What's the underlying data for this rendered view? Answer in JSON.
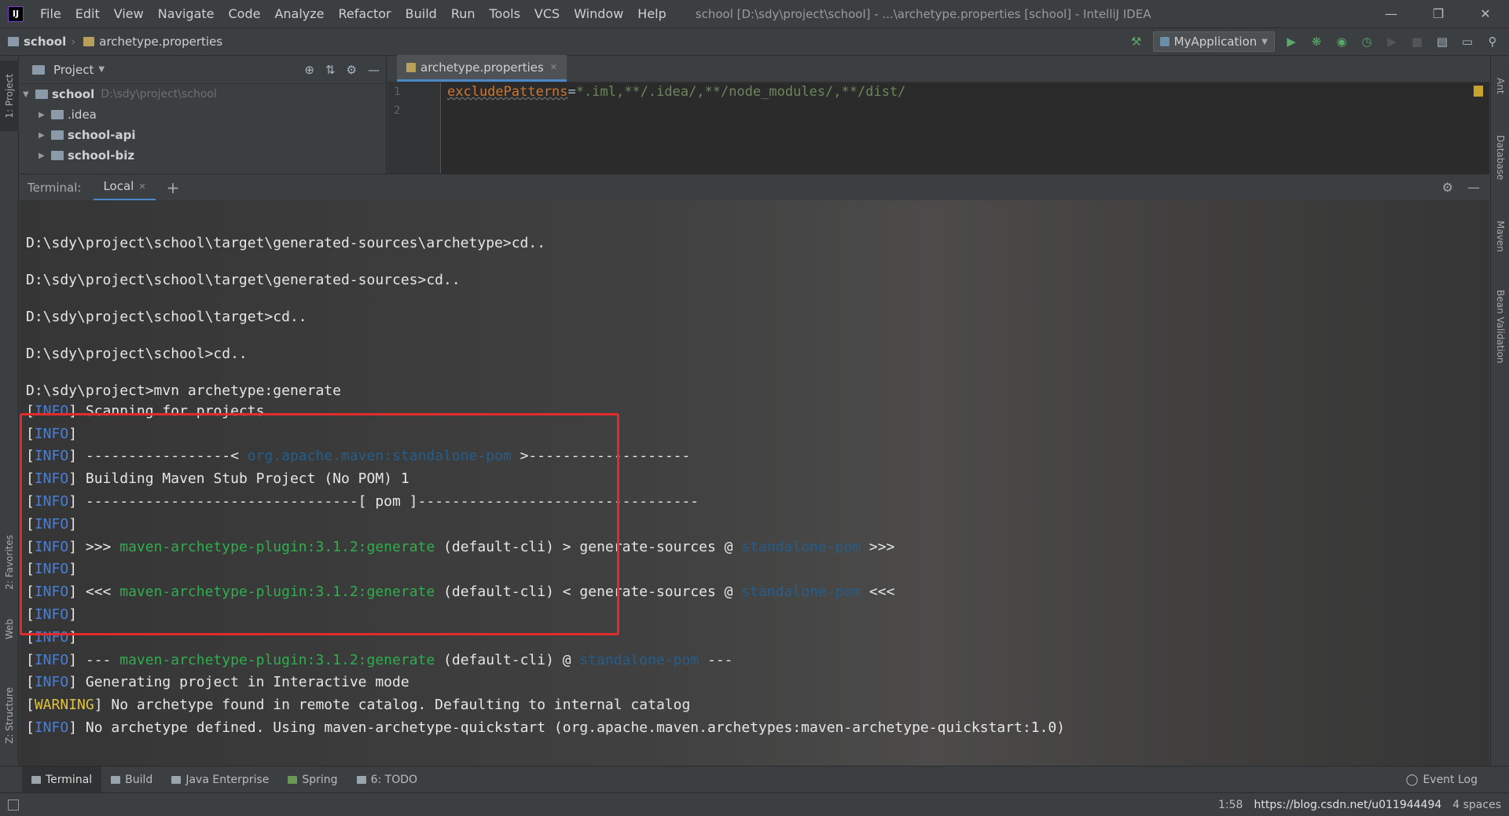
{
  "menubar": {
    "logo_text": "IJ",
    "items": [
      "File",
      "Edit",
      "View",
      "Navigate",
      "Code",
      "Analyze",
      "Refactor",
      "Build",
      "Run",
      "Tools",
      "VCS",
      "Window",
      "Help"
    ],
    "window_title": "school [D:\\sdy\\project\\school] - ...\\archetype.properties [school] - IntelliJ IDEA",
    "controls": [
      "minimize-icon",
      "restore-icon",
      "close-icon"
    ]
  },
  "navbar": {
    "breadcrumbs": [
      "school",
      "archetype.properties"
    ],
    "run_config": "MyApplication"
  },
  "left_strip": {
    "tabs": [
      "1: Project",
      "2: Favorites",
      "Web",
      "Z: Structure"
    ]
  },
  "right_strip": {
    "tabs": [
      "Ant",
      "Database",
      "Maven",
      "Bean Validation"
    ]
  },
  "project_panel": {
    "title": "Project",
    "root": {
      "name": "school",
      "path": "D:\\sdy\\project\\school"
    },
    "children": [
      ".idea",
      "school-api",
      "school-biz"
    ]
  },
  "editor": {
    "tab": "archetype.properties",
    "line_numbers": [
      "1",
      "2"
    ],
    "line1": {
      "key": "excludePatterns",
      "eq": "=",
      "value": "*.iml,**/.idea/,**/node_modules/,**/dist/"
    }
  },
  "terminal": {
    "label": "Terminal:",
    "tab": "Local",
    "lines": [
      {
        "text": ""
      },
      {
        "text": "D:\\sdy\\project\\school\\target\\generated-sources\\archetype>cd.."
      },
      {
        "text": ""
      },
      {
        "text": "D:\\sdy\\project\\school\\target\\generated-sources>cd.."
      },
      {
        "text": ""
      },
      {
        "text": "D:\\sdy\\project\\school\\target>cd.."
      },
      {
        "text": ""
      },
      {
        "text": "D:\\sdy\\project\\school>cd.."
      },
      {
        "text": ""
      },
      {
        "text": "D:\\sdy\\project>mvn archetype:generate"
      }
    ],
    "log": [
      {
        "level": "INFO",
        "parts": [
          {
            "t": " Scanning for projects...",
            "c": ""
          }
        ]
      },
      {
        "level": "INFO",
        "parts": []
      },
      {
        "level": "INFO",
        "parts": [
          {
            "t": " -----------------< ",
            "c": ""
          },
          {
            "t": "org.apache.maven:standalone-pom",
            "c": "dim"
          },
          {
            "t": " >-------------------",
            "c": ""
          }
        ]
      },
      {
        "level": "INFO",
        "parts": [
          {
            "t": " Building Maven Stub Project (No POM) 1",
            "c": ""
          }
        ]
      },
      {
        "level": "INFO",
        "parts": [
          {
            "t": " --------------------------------[ pom ]---------------------------------",
            "c": ""
          }
        ]
      },
      {
        "level": "INFO",
        "parts": []
      },
      {
        "level": "INFO",
        "parts": [
          {
            "t": " >>> ",
            "c": ""
          },
          {
            "t": "maven-archetype-plugin:3.1.2:generate",
            "c": "plugin"
          },
          {
            "t": " (default-cli) > generate-sources @ ",
            "c": ""
          },
          {
            "t": "standalone-pom",
            "c": "dim"
          },
          {
            "t": " >>>",
            "c": ""
          }
        ]
      },
      {
        "level": "INFO",
        "parts": []
      },
      {
        "level": "INFO",
        "parts": [
          {
            "t": " <<< ",
            "c": ""
          },
          {
            "t": "maven-archetype-plugin:3.1.2:generate",
            "c": "plugin"
          },
          {
            "t": " (default-cli) < generate-sources @ ",
            "c": ""
          },
          {
            "t": "standalone-pom",
            "c": "dim"
          },
          {
            "t": " <<<",
            "c": ""
          }
        ]
      },
      {
        "level": "INFO",
        "parts": []
      },
      {
        "level": "INFO",
        "parts": []
      },
      {
        "level": "INFO",
        "parts": [
          {
            "t": " --- ",
            "c": ""
          },
          {
            "t": "maven-archetype-plugin:3.1.2:generate",
            "c": "plugin"
          },
          {
            "t": " (default-cli) @ ",
            "c": ""
          },
          {
            "t": "standalone-pom",
            "c": "dim"
          },
          {
            "t": " ---",
            "c": ""
          }
        ]
      },
      {
        "level": "INFO",
        "parts": [
          {
            "t": " Generating project in Interactive mode",
            "c": ""
          }
        ]
      },
      {
        "level": "WARNING",
        "parts": [
          {
            "t": " No archetype found in remote catalog. Defaulting to internal catalog",
            "c": ""
          }
        ]
      },
      {
        "level": "INFO",
        "parts": [
          {
            "t": " No archetype defined. Using maven-archetype-quickstart (org.apache.maven.archetypes:maven-archetype-quickstart:1.0)",
            "c": ""
          }
        ]
      }
    ]
  },
  "bottom_tabs": [
    "Terminal",
    "Build",
    "Java Enterprise",
    "Spring",
    "6: TODO"
  ],
  "event_log": "Event Log",
  "status": {
    "position": "1:58",
    "watermark": "https://blog.csdn.net/u011944494",
    "extra": "4 spaces"
  },
  "colors": {
    "accent": "#4a88c7",
    "highlight_box": "#e32b2b",
    "info": "#4a7fd6",
    "warning": "#e2c23d",
    "plugin": "#2fae4d"
  }
}
